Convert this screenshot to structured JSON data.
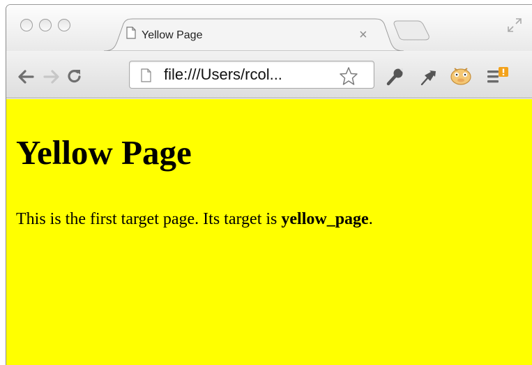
{
  "browser": {
    "tab": {
      "title": "Yellow Page",
      "close_glyph": "×"
    },
    "toolbar": {
      "url": "file:///Users/rcol...",
      "icons": [
        "back-icon",
        "forward-icon",
        "reload-icon",
        "bookmark-star-icon",
        "wrench-icon",
        "pin-icon",
        "extension-icon",
        "menu-icon"
      ]
    }
  },
  "page": {
    "background": "#ffff00",
    "heading": "Yellow Page",
    "text_before": "This is the first target page. Its target is ",
    "text_bold": "yellow_page",
    "text_after": "."
  }
}
